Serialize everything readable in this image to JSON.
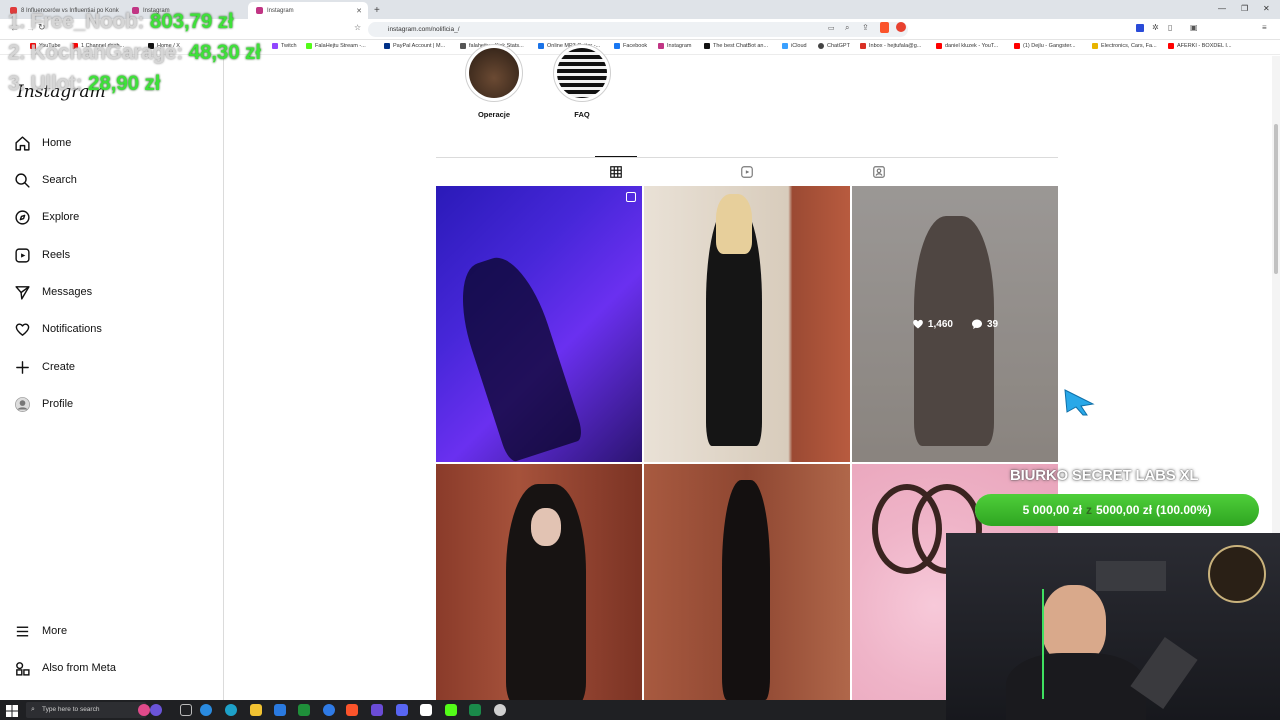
{
  "browser": {
    "tabs": [
      {
        "label": "8 Influencerów vs Influentiai po Konk",
        "color": "#e03b3b"
      },
      {
        "label": "Instagram",
        "color": "#c13584"
      },
      {
        "label": "Instagram",
        "color": "#c13584"
      }
    ],
    "url": "instagram.com/nolificia_/",
    "bookmarks": [
      {
        "label": "YouTube",
        "color": "#ff0000"
      },
      {
        "label": "1 Channel dash...",
        "color": "#ff0000"
      },
      {
        "label": "Home / X",
        "color": "#111111"
      },
      {
        "label": "Twitch",
        "color": "#9146ff"
      },
      {
        "label": "FalaHejtu Stream -...",
        "color": "#53fc18"
      },
      {
        "label": "PayPal Account | M...",
        "color": "#003087"
      },
      {
        "label": "falahejtu - Kick Stats...",
        "color": "#555555"
      },
      {
        "label": "Online MP3 Cutter -...",
        "color": "#1a73e8"
      },
      {
        "label": "Facebook",
        "color": "#1877f2"
      },
      {
        "label": "Instagram",
        "color": "#c13584"
      },
      {
        "label": "The best ChatBot an...",
        "color": "#111111"
      },
      {
        "label": "iCloud",
        "color": "#3aa0ff"
      },
      {
        "label": "ChatGPT",
        "color": "#444444"
      },
      {
        "label": "Inbox - hejtufala@g...",
        "color": "#d93025"
      },
      {
        "label": "daniel kluzek - YouT...",
        "color": "#ff0000"
      },
      {
        "label": "(1) Dejlu - Gangster...",
        "color": "#ff0000"
      },
      {
        "label": "Electronics, Cars, Fa...",
        "color": "#e8b400"
      },
      {
        "label": "AFERKI - BOXDEL I...",
        "color": "#ff0000"
      }
    ]
  },
  "donors": [
    {
      "name": "1. Free_Noob:",
      "amount": "803,79 zł"
    },
    {
      "name": "2. KochanGarage:",
      "amount": "48,30 zł"
    },
    {
      "name": "3. Ullot:",
      "amount": "28,90 zł"
    }
  ],
  "sidebar": {
    "logo": "Instagram",
    "items": [
      {
        "label": "Home",
        "icon": "home-icon"
      },
      {
        "label": "Search",
        "icon": "search-icon"
      },
      {
        "label": "Explore",
        "icon": "compass-icon"
      },
      {
        "label": "Reels",
        "icon": "reels-icon"
      },
      {
        "label": "Messages",
        "icon": "messages-icon"
      },
      {
        "label": "Notifications",
        "icon": "heart-icon"
      },
      {
        "label": "Create",
        "icon": "plus-icon"
      },
      {
        "label": "Profile",
        "icon": "avatar-icon"
      }
    ],
    "more": "More",
    "meta": "Also from Meta"
  },
  "highlights": [
    {
      "label": "Operacje"
    },
    {
      "label": "FAQ"
    }
  ],
  "profile_tabs": [
    {
      "name": "posts",
      "icon": "grid-icon",
      "active": true
    },
    {
      "name": "reels",
      "icon": "reels-icon",
      "active": false
    },
    {
      "name": "tagged",
      "icon": "tagged-icon",
      "active": false
    }
  ],
  "posts_hover": {
    "likes": "1,460",
    "comments": "39"
  },
  "goal": {
    "title": "BIURKO SECRET LABS XL",
    "current": "5 000,00 zł",
    "connector": "z",
    "target": "5000,00 zł",
    "percent_text": "(100.00%)",
    "fraction": 1.0
  },
  "taskbar": {
    "search_placeholder": "Type here to search"
  }
}
